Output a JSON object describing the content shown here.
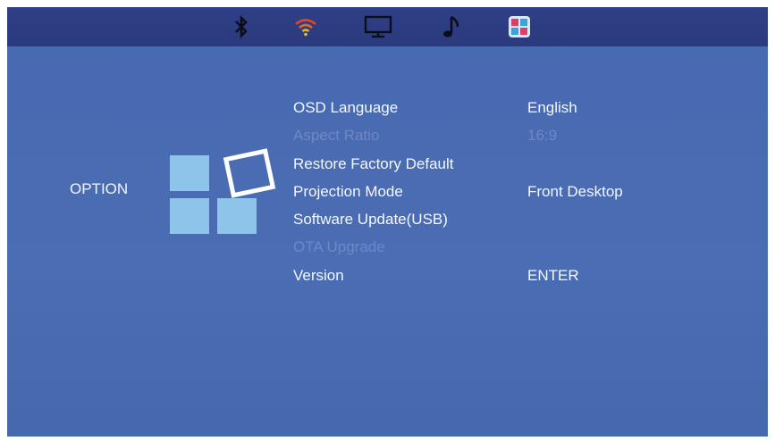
{
  "topbar": {
    "icons": [
      {
        "name": "bluetooth-icon"
      },
      {
        "name": "wifi-icon"
      },
      {
        "name": "monitor-icon"
      },
      {
        "name": "music-icon"
      },
      {
        "name": "settings-tile-icon"
      }
    ]
  },
  "section": {
    "title": "OPTION"
  },
  "menu": {
    "items": [
      {
        "label": "OSD Language",
        "value": "English",
        "enabled": true
      },
      {
        "label": "Aspect Ratio",
        "value": "16:9",
        "enabled": false
      },
      {
        "label": "Restore Factory Default",
        "value": "",
        "enabled": true
      },
      {
        "label": "Projection Mode",
        "value": "Front Desktop",
        "enabled": true
      },
      {
        "label": "Software Update(USB)",
        "value": "",
        "enabled": true
      },
      {
        "label": "OTA Upgrade",
        "value": "",
        "enabled": false
      },
      {
        "label": "Version",
        "value": "ENTER",
        "enabled": true
      }
    ]
  },
  "colors": {
    "background": "#4769b1",
    "topbar": "#2f3f86",
    "disabled_text": "#6e88c6",
    "tile": "#8fc4ea"
  }
}
